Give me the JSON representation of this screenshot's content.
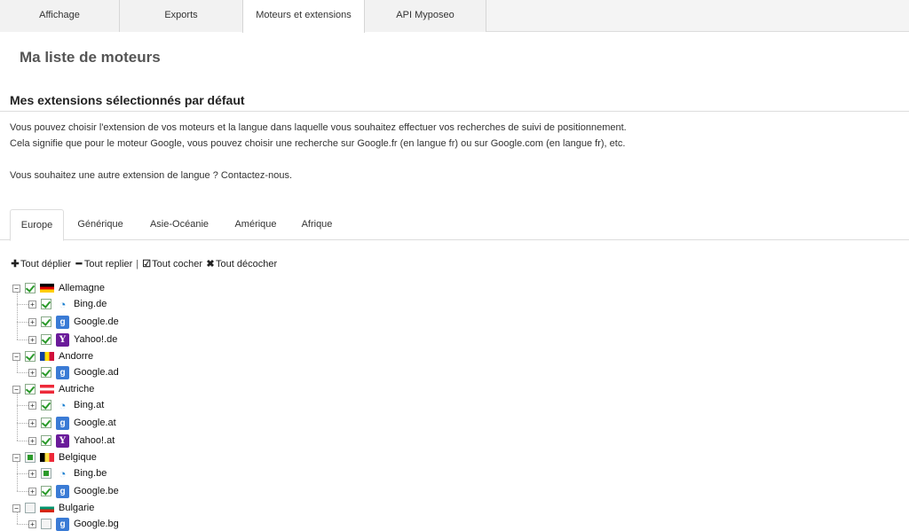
{
  "top_tabs": [
    {
      "label": "Affichage",
      "active": false
    },
    {
      "label": "Exports",
      "active": false
    },
    {
      "label": "Moteurs et extensions",
      "active": true
    },
    {
      "label": "API Myposeo",
      "active": false
    }
  ],
  "page_title": "Ma liste de moteurs",
  "section_title": "Mes extensions sélectionnés par défaut",
  "intro": {
    "line1": "Vous pouvez choisir l'extension de vos moteurs et la langue dans laquelle vous souhaitez effectuer vos recherches de suivi de positionnement.",
    "line2": "Cela signifie que pour le moteur Google, vous pouvez choisir une recherche sur Google.fr (en langue fr) ou sur Google.com (en langue fr), etc.",
    "line3": "Vous souhaitez une autre extension de langue ? Contactez-nous."
  },
  "region_tabs": [
    {
      "label": "Europe",
      "active": true
    },
    {
      "label": "Générique",
      "active": false
    },
    {
      "label": "Asie-Océanie",
      "active": false
    },
    {
      "label": "Amérique",
      "active": false
    },
    {
      "label": "Afrique",
      "active": false
    }
  ],
  "toolbar": {
    "expand_all": "Tout déplier",
    "collapse_all": "Tout replier",
    "separator": "|",
    "check_all": "Tout cocher",
    "uncheck_all": "Tout décocher"
  },
  "tree": [
    {
      "country": "Allemagne",
      "flag": "de",
      "state": "checked",
      "engines": [
        {
          "label": "Bing.de",
          "engine": "bing",
          "checked": true
        },
        {
          "label": "Google.de",
          "engine": "google",
          "checked": true
        },
        {
          "label": "Yahoo!.de",
          "engine": "yahoo",
          "checked": true
        }
      ]
    },
    {
      "country": "Andorre",
      "flag": "ad",
      "state": "checked",
      "engines": [
        {
          "label": "Google.ad",
          "engine": "google",
          "checked": true
        }
      ]
    },
    {
      "country": "Autriche",
      "flag": "at",
      "state": "checked",
      "engines": [
        {
          "label": "Bing.at",
          "engine": "bing",
          "checked": true
        },
        {
          "label": "Google.at",
          "engine": "google",
          "checked": true
        },
        {
          "label": "Yahoo!.at",
          "engine": "yahoo",
          "checked": true
        }
      ]
    },
    {
      "country": "Belgique",
      "flag": "be",
      "state": "partial",
      "engines": [
        {
          "label": "Bing.be",
          "engine": "bing",
          "checked": false
        },
        {
          "label": "Google.be",
          "engine": "google",
          "checked": true
        }
      ]
    },
    {
      "country": "Bulgarie",
      "flag": "bg",
      "state": "unchecked",
      "engines": [
        {
          "label": "Google.bg",
          "engine": "google",
          "checked": false
        }
      ]
    }
  ],
  "icons": {
    "expand_all": "plus-icon",
    "collapse_all": "minus-icon",
    "check_all": "checkbox-icon",
    "uncheck_all": "cross-icon",
    "bing": "bing-logo-icon",
    "google": "google-logo-icon",
    "yahoo": "yahoo-logo-icon"
  },
  "colors": {
    "check_green": "#2a9a2a",
    "google_blue": "#3a7bd5",
    "yahoo_purple": "#6a1b9a",
    "bing_blue": "#1a7fd0"
  }
}
